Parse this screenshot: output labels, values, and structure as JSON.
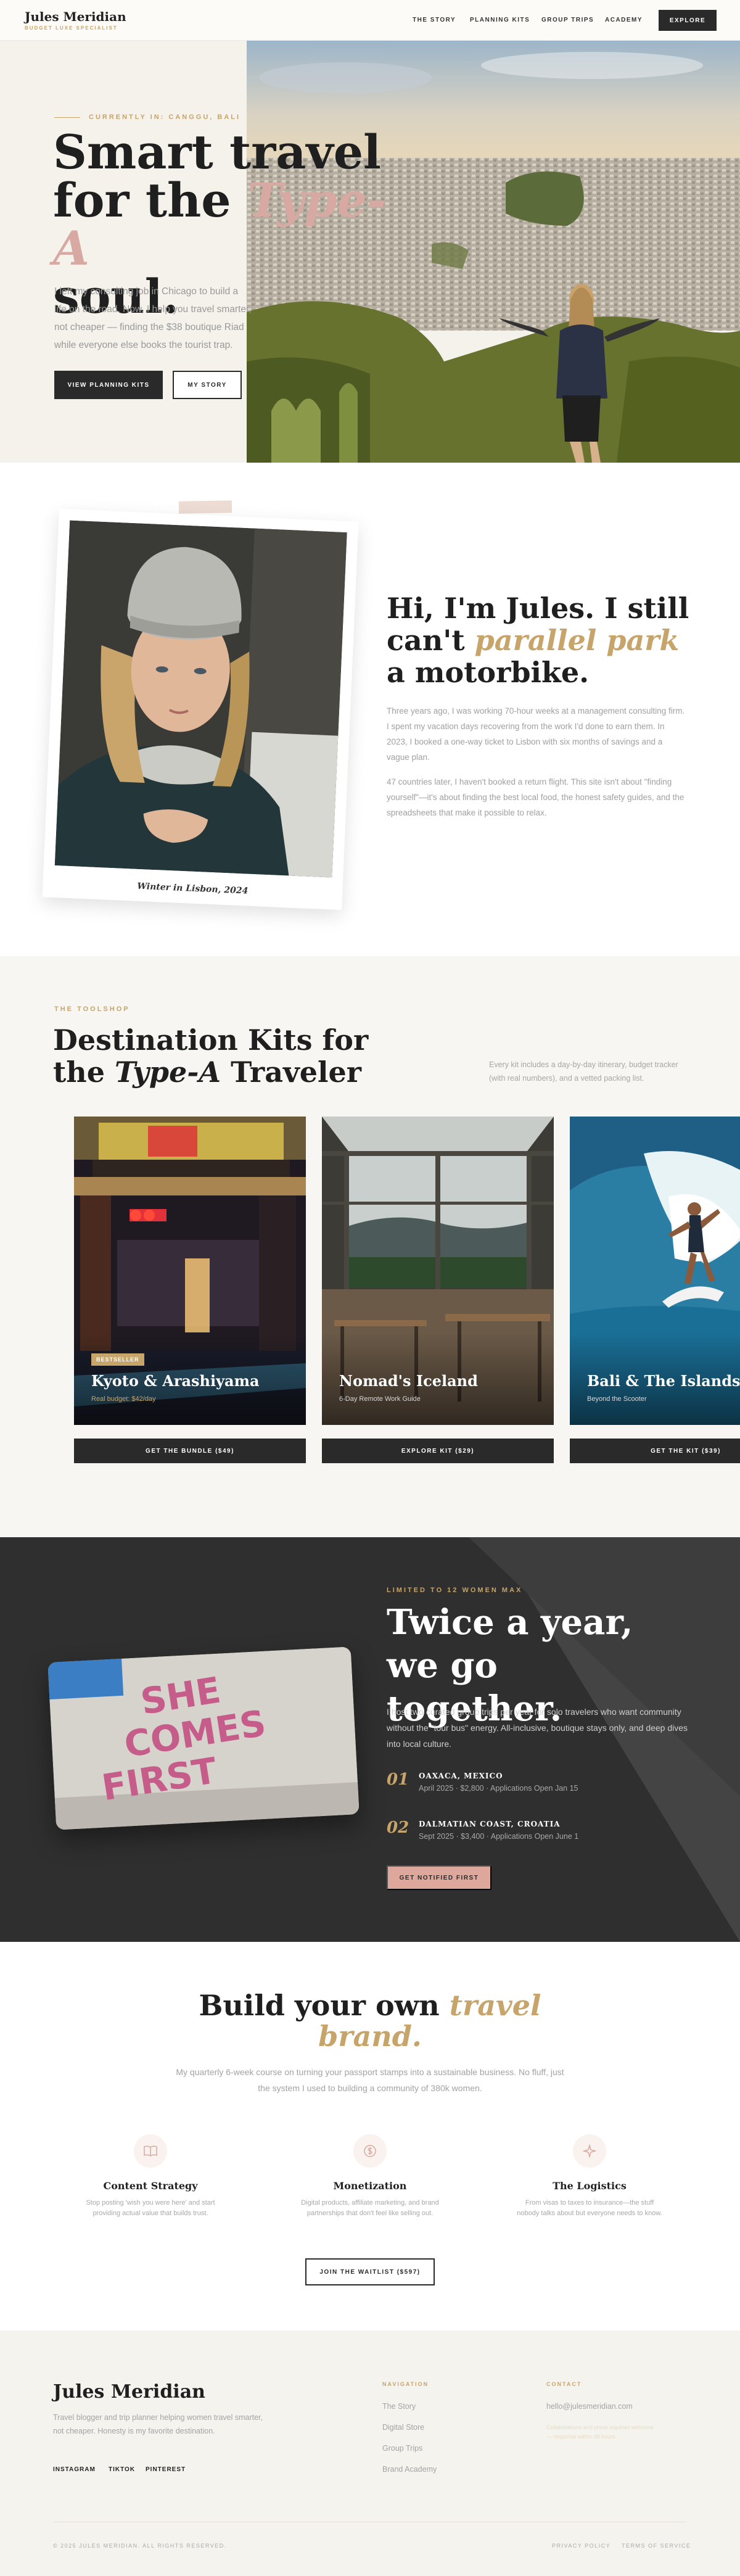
{
  "nav": {
    "logo": "Jules Meridian",
    "tagline": "BUDGET LUXE SPECIALIST",
    "links": [
      "THE STORY",
      "PLANNING KITS",
      "GROUP TRIPS",
      "ACADEMY"
    ],
    "cta": "EXPLORE"
  },
  "hero": {
    "eyebrow": "CURRENTLY IN: CANGGU, BALI",
    "title_line1": "Smart travel",
    "title_line2a": "for the ",
    "title_accent": "Type-A",
    "title_line3": "soul.",
    "text": "I left my consulting job in Chicago to build a life on the road. Now, I help you travel smarter, not cheaper — finding the $38 boutique Riad while everyone else books the tourist trap.",
    "btn_primary": "VIEW PLANNING KITS",
    "btn_secondary": "MY STORY"
  },
  "about": {
    "caption": "Winter in Lisbon, 2024",
    "title_a": "Hi, I'm Jules. I still can't ",
    "title_accent": "parallel park",
    "title_b": " a motorbike.",
    "p1": "Three years ago, I was working 70-hour weeks at a management consulting firm. I spent my vacation days recovering from the work I'd done to earn them. In 2023, I booked a one-way ticket to Lisbon with six months of savings and a vague plan.",
    "p2": "47 countries later, I haven't booked a return flight. This site isn't about \"finding yourself\"—it's about finding the best local food, the honest safety guides, and the spreadsheets that make it possible to relax."
  },
  "kits": {
    "eyebrow": "THE TOOLSHOP",
    "title_a": "Destination Kits for",
    "title_b": "the ",
    "title_accent": "Type-A",
    "title_c": " Traveler",
    "description": "Every kit includes a day-by-day itinerary, budget tracker (with real numbers), and a vetted packing list.",
    "items": [
      {
        "name": "Kyoto & Arashiyama",
        "badge": "BESTSELLER",
        "sub": "Real budget: $42/day",
        "button": "GET THE BUNDLE ($49)"
      },
      {
        "name": "Nomad's Iceland",
        "badge": "",
        "sub": "6-Day Remote Work Guide",
        "button": "EXPLORE KIT ($29)"
      },
      {
        "name": "Bali & The Islands",
        "badge": "",
        "sub": "Beyond the Scooter",
        "button": "GET THE KIT ($39)"
      }
    ]
  },
  "trips": {
    "eyebrow": "LIMITED TO 12 WOMEN MAX",
    "title": "Twice a year, we go together.",
    "text": "I host two curated group trips per year for solo travelers who want community without the \"tour bus\" energy. All-inclusive, boutique stays only, and deep dives into local culture.",
    "photo_text": [
      "SHE",
      "COMES",
      "FIRST"
    ],
    "items": [
      {
        "num": "01",
        "name": "OAXACA, MEXICO",
        "detail": "April 2025 · $2,800 · Applications Open Jan 15"
      },
      {
        "num": "02",
        "name": "DALMATIAN COAST, CROATIA",
        "detail": "Sept 2025 · $3,400 · Applications Open June 1"
      }
    ],
    "button": "GET NOTIFIED FIRST"
  },
  "brand": {
    "title_a": "Build your own ",
    "title_accent1": "travel",
    "title_accent2": "brand.",
    "text": "My quarterly 6-week course on turning your passport stamps into a sustainable business. No fluff, just the system I used to building a community of 380k women.",
    "features": [
      {
        "icon": "book-icon",
        "title": "Content Strategy",
        "text": "Stop posting 'wish you were here' and start providing actual value that builds trust."
      },
      {
        "icon": "dollar-icon",
        "title": "Monetization",
        "text": "Digital products, affiliate marketing, and brand partnerships that don't feel like selling out."
      },
      {
        "icon": "sparkle-icon",
        "title": "The Logistics",
        "text": "From visas to taxes to insurance—the stuff nobody talks about but everyone needs to know."
      }
    ],
    "button": "JOIN THE WAITLIST ($597)"
  },
  "footer": {
    "logo": "Jules Meridian",
    "description": "Travel blogger and trip planner helping women travel smarter, not cheaper. Honesty is my favorite destination.",
    "social": [
      "INSTAGRAM",
      "TIKTOK",
      "PINTEREST"
    ],
    "nav_title": "NAVIGATION",
    "nav_links": [
      "The Story",
      "Digital Store",
      "Group Trips",
      "Brand Academy"
    ],
    "contact_title": "CONTACT",
    "email": "hello@julesmeridian.com",
    "note": "Collaborations and press inquiries welcome — response within 48 hours.",
    "copyright": "© 2025 JULES MERIDIAN. ALL RIGHTS RESERVED.",
    "legal": [
      "PRIVACY POLICY",
      "TERMS OF SERVICE"
    ]
  },
  "colors": {
    "gold": "#c6a46a",
    "pink": "#d8a9a2",
    "dark": "#2f2f2f",
    "cream": "#faf8f4"
  }
}
